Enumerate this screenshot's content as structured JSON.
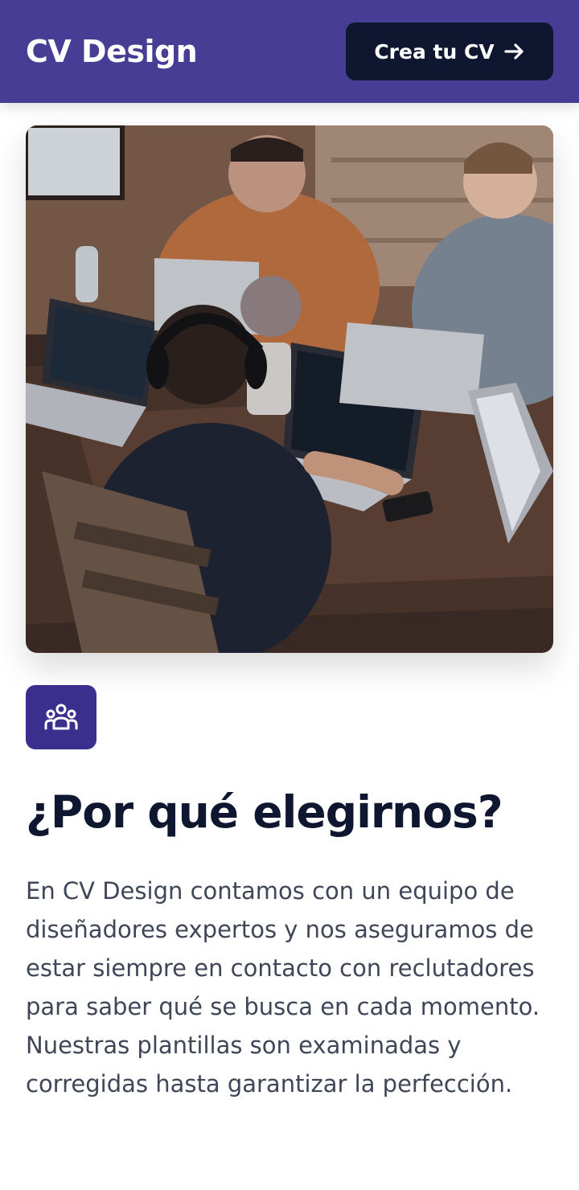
{
  "header": {
    "brand": "CV Design",
    "cta_label": "Crea tu CV",
    "cta_icon": "arrow-right-icon",
    "background_color": "#473d94",
    "cta_color": "#0f1730"
  },
  "hero": {
    "image_subject": "people working on laptops around a wooden table"
  },
  "feature": {
    "icon": "users-group-icon",
    "icon_background_color": "#3a2f8c",
    "title": "¿Por qué elegirnos?",
    "description": "En CV Design contamos con un equipo de diseñadores expertos y nos aseguramos de estar siempre en contacto con reclutadores para saber qué se busca en cada momento. Nuestras plantillas son examinadas y corregidas hasta garantizar la perfección."
  }
}
